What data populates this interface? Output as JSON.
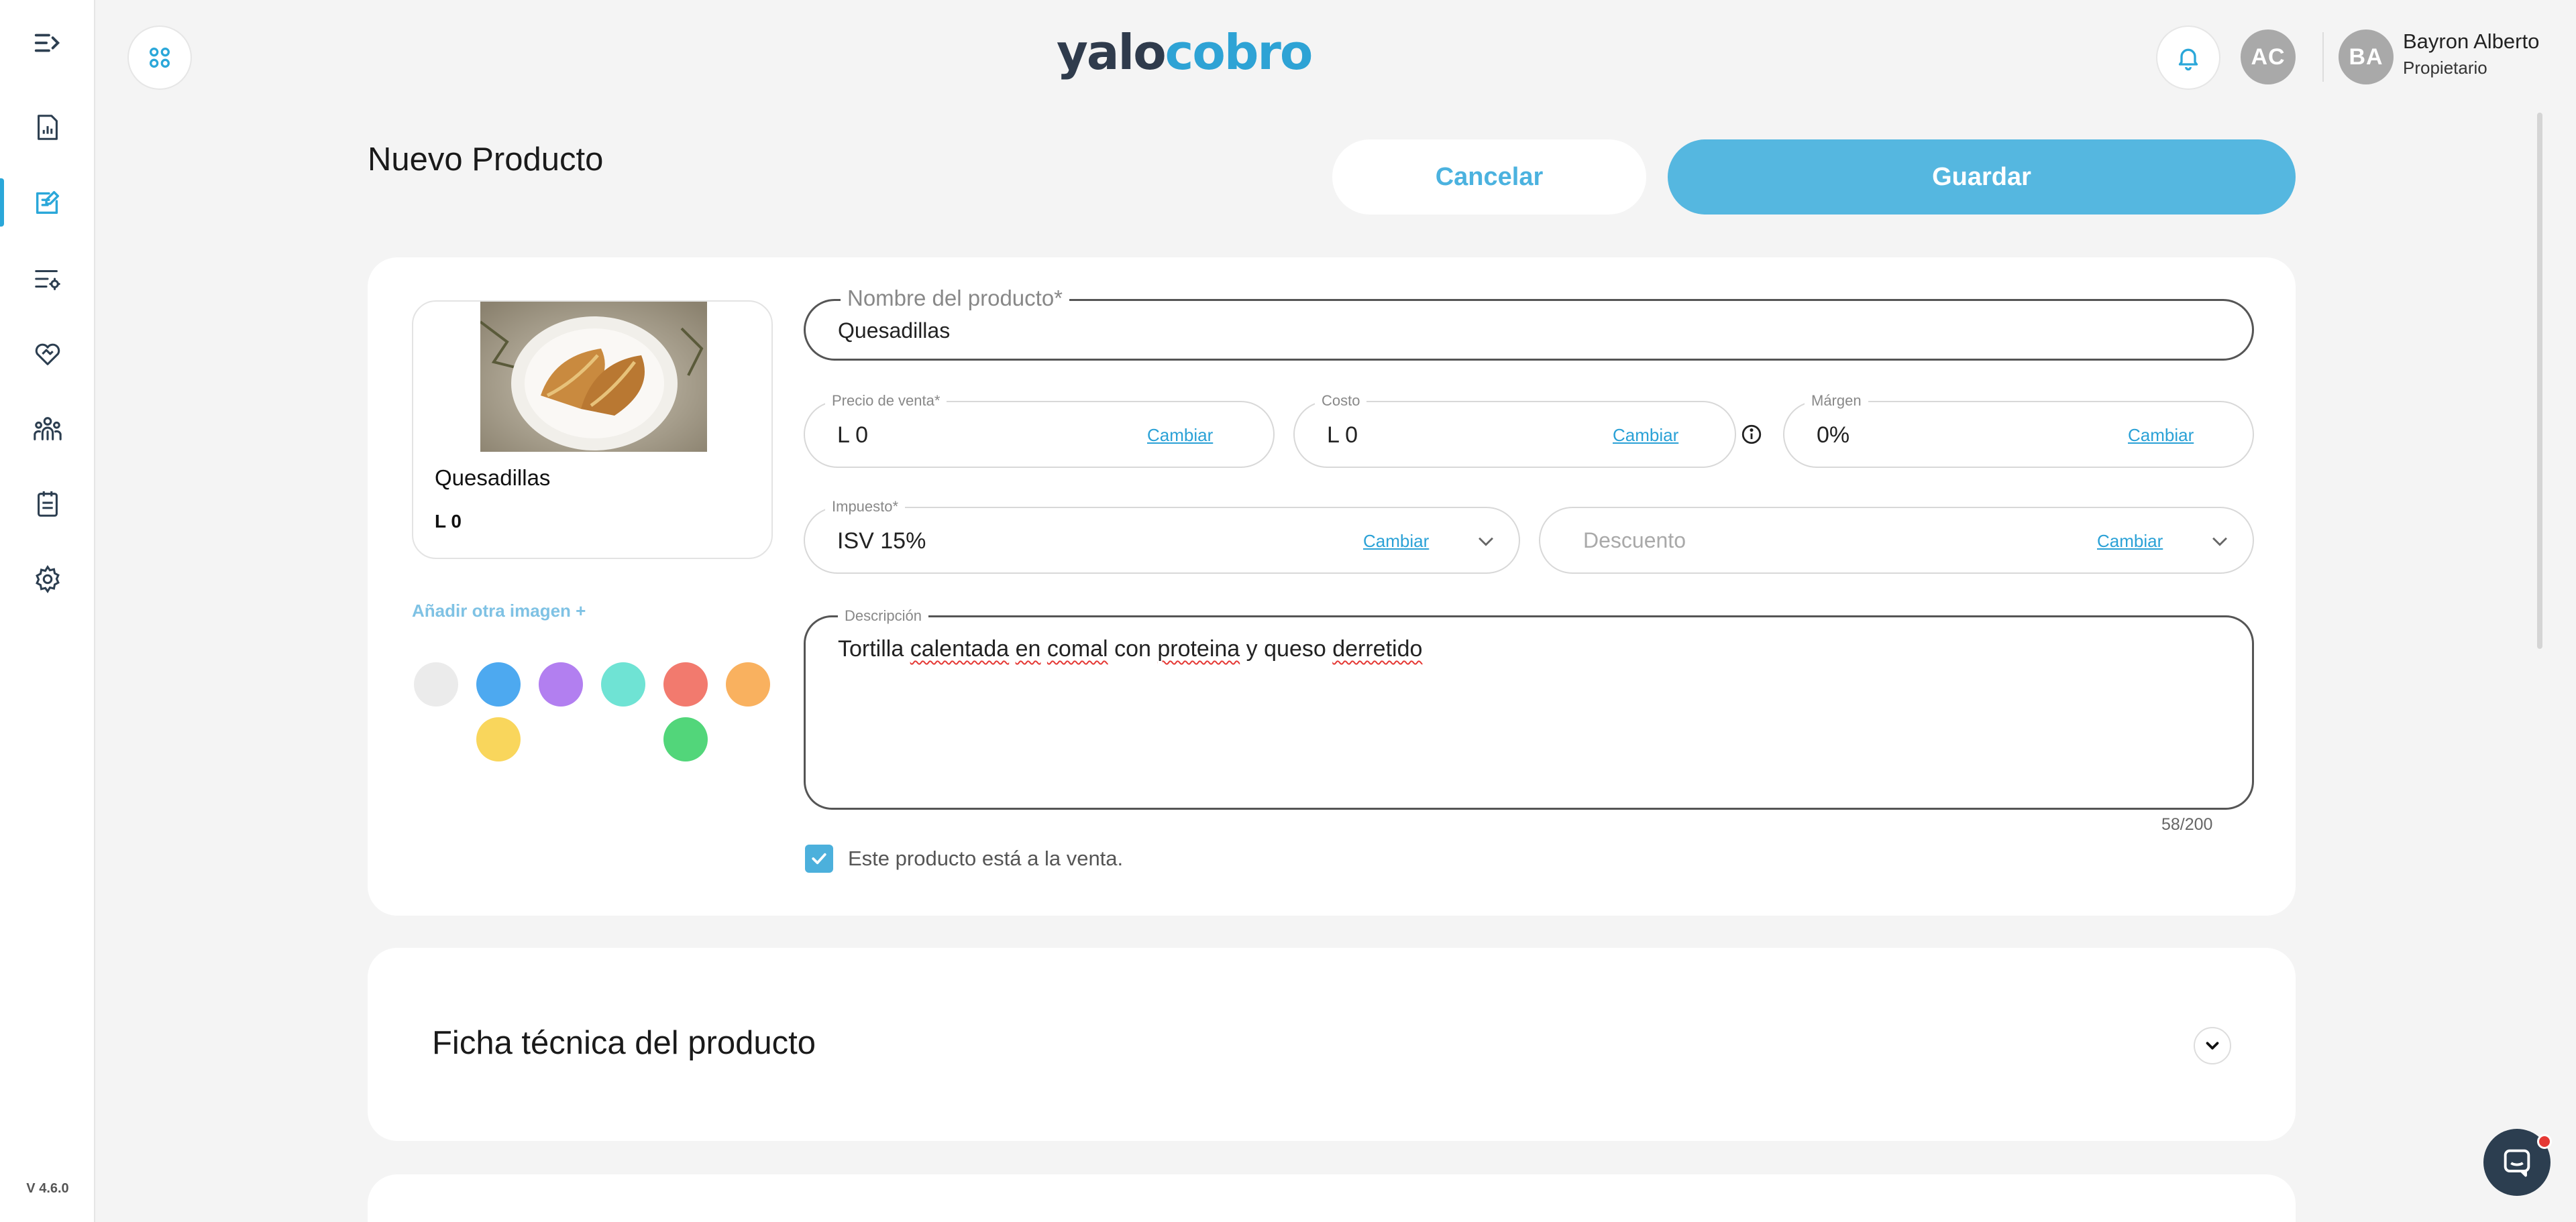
{
  "app": {
    "logo_part1": "yalo",
    "logo_part2": "cobro",
    "version": "V 4.6.0"
  },
  "sidebar": {
    "items": [
      {
        "icon": "menu-collapse-icon"
      },
      {
        "icon": "report-chart-icon"
      },
      {
        "icon": "edit-document-icon",
        "active": true
      },
      {
        "icon": "list-settings-icon"
      },
      {
        "icon": "handshake-icon"
      },
      {
        "icon": "users-group-icon"
      },
      {
        "icon": "clipboard-list-icon"
      },
      {
        "icon": "gear-icon"
      }
    ]
  },
  "header": {
    "avatar_initials_1": "AC",
    "avatar_initials_2": "BA",
    "user_name": "Bayron Alberto",
    "user_role": "Propietario"
  },
  "page": {
    "title": "Nuevo Producto",
    "cancel_label": "Cancelar",
    "save_label": "Guardar"
  },
  "preview": {
    "name": "Quesadillas",
    "price": "L 0",
    "add_image_label": "Añadir otra imagen +",
    "swatches": [
      "#ebebeb",
      "#4da9f0",
      "#b27ff0",
      "#6fe3d4",
      "#f27a6e",
      "#f9b15f",
      "#f9d65c",
      "#52d67a"
    ]
  },
  "form": {
    "name_label": "Nombre del producto*",
    "name_value": "Quesadillas",
    "price_label": "Precio de venta*",
    "price_value": "L 0",
    "cost_label": "Costo",
    "cost_value": "L 0",
    "margin_label": "Márgen",
    "margin_value": "0%",
    "change_label": "Cambiar",
    "tax_label": "Impuesto*",
    "tax_value": "ISV 15%",
    "discount_placeholder": "Descuento",
    "desc_label": "Descripción",
    "desc_words": [
      "Tortilla",
      "calentada",
      "en",
      "comal",
      "con",
      "proteina",
      "y",
      "queso",
      "derretido"
    ],
    "desc_counter": "58/200",
    "on_sale_label": "Este producto está a la venta.",
    "on_sale_checked": true
  },
  "ficha": {
    "title": "Ficha técnica del producto"
  },
  "colors": {
    "accent": "#2aa7d9",
    "save_button": "#55b7e0",
    "background": "#f4f4f4"
  }
}
